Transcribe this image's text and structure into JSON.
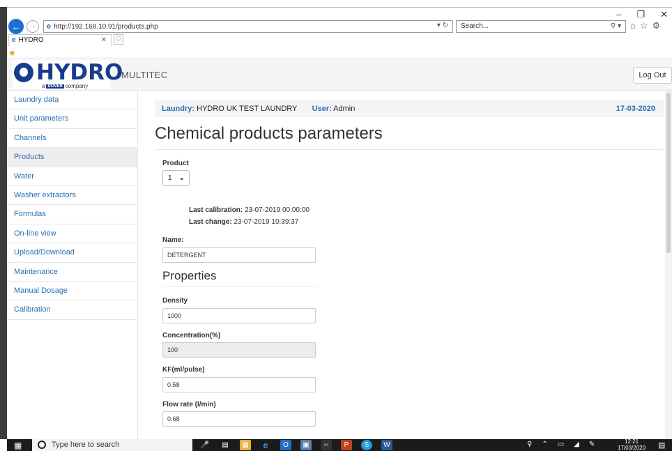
{
  "browser": {
    "url": "http://192.168.10.91/products.php",
    "search_placeholder": "Search...",
    "tab_title": "HYDRO"
  },
  "header": {
    "brand": "HYDRO",
    "brand_sub_a": "a",
    "brand_sub_dover": "DOVER",
    "brand_sub_company": "company",
    "app_name": "MULTITEC",
    "logout_label": "Log Out"
  },
  "sidebar": {
    "items": [
      {
        "label": "Laundry data"
      },
      {
        "label": "Unit parameters"
      },
      {
        "label": "Channels"
      },
      {
        "label": "Products"
      },
      {
        "label": "Water"
      },
      {
        "label": "Washer extractors"
      },
      {
        "label": "Formulas"
      },
      {
        "label": "On-line view"
      },
      {
        "label": "Upload/Download"
      },
      {
        "label": "Maintenance"
      },
      {
        "label": "Manual Dosage"
      },
      {
        "label": "Calibration"
      }
    ]
  },
  "infobar": {
    "laundry_label": "Laundry:",
    "laundry_value": "HYDRO UK TEST LAUNDRY",
    "user_label": "User:",
    "user_value": "Admin",
    "date": "17-03-2020"
  },
  "main": {
    "title": "Chemical products parameters",
    "product_label": "Product",
    "product_value": "1",
    "last_calibration_label": "Last calibration:",
    "last_calibration_value": "23-07-2019 00:00:00",
    "last_change_label": "Last change:",
    "last_change_value": "23-07-2019 10:39:37",
    "name_label": "Name:",
    "name_value": "DETERGENT",
    "properties_title": "Properties",
    "density_label": "Density",
    "density_value": "1000",
    "concentration_label": "Concentration(%)",
    "concentration_value": "100",
    "kf_label": "KF(ml/pulse)",
    "kf_value": "0.58",
    "flow_label": "Flow rate (l/min)",
    "flow_value": "0.68"
  },
  "taskbar": {
    "search_placeholder": "Type here to search",
    "time": "12:21",
    "date": "17/03/2020"
  }
}
